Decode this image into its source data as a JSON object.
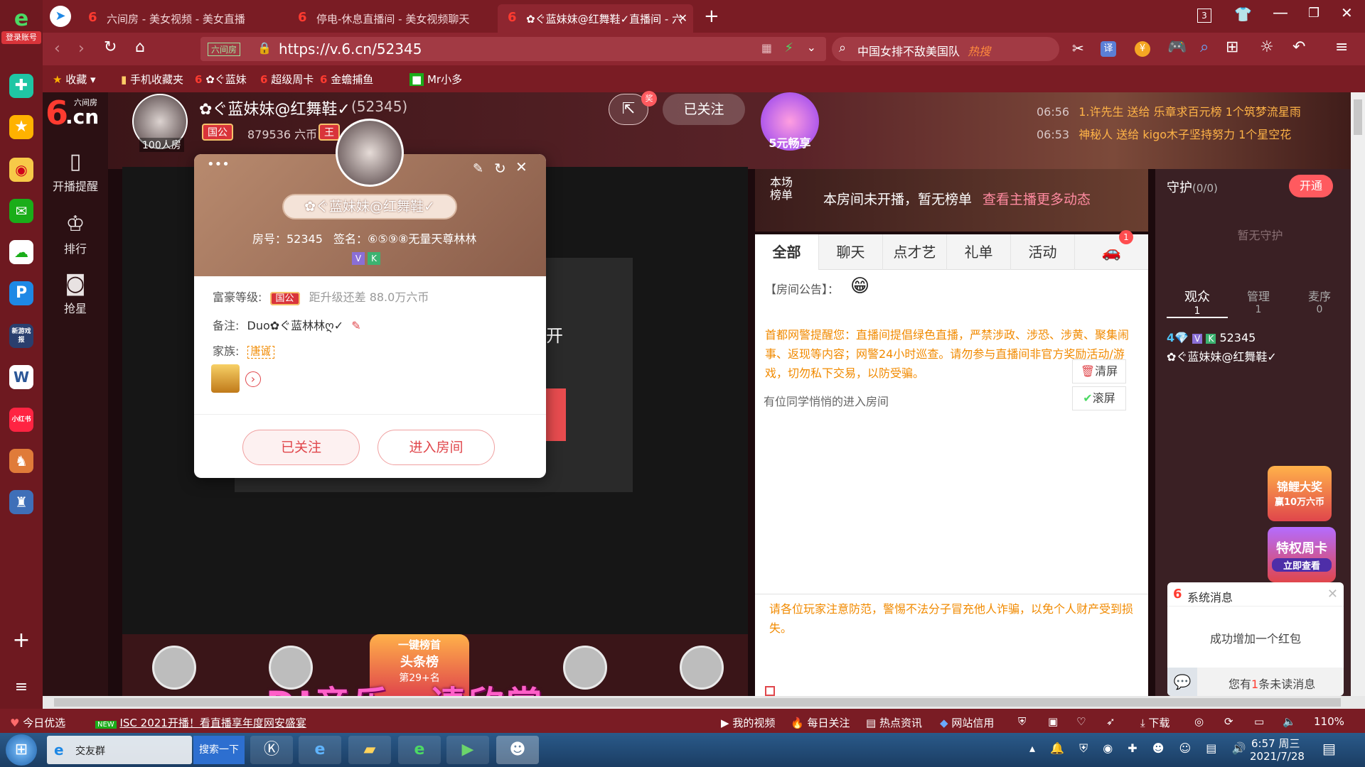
{
  "left_sidebar": {
    "account_label": "登录账号",
    "icons": [
      "browser-logo-icon",
      "plus-cross-icon",
      "star-icon",
      "weibo-icon",
      "mail-icon",
      "cloud-icon",
      "p-app-icon",
      "game-news-icon",
      "word-doc-icon",
      "xiaohongshu-icon",
      "game-icon",
      "game-icon-2",
      "add-icon",
      "menu-icon"
    ],
    "game_news_label": "新游戏报",
    "xhs_label": "小红书"
  },
  "tabs": [
    {
      "label": "六间房 - 美女视频 - 美女直播"
    },
    {
      "label": "停电-休息直播间 - 美女视频聊天"
    },
    {
      "label": "✿ぐ蓝妹妹@红舞鞋✓直播间 - 六"
    }
  ],
  "window_counter": "3",
  "navbar": {
    "url": "https://v.6.cn/52345",
    "url_badge": "六间房",
    "search_text": "中国女排不敌美国队",
    "search_badge": "热搜",
    "translate_label": "译"
  },
  "bookmarks": [
    {
      "label": "收藏"
    },
    {
      "label": "手机收藏夹"
    },
    {
      "label": "✿ぐ蓝妹"
    },
    {
      "label": "超级周卡"
    },
    {
      "label": "金蟾捕鱼"
    },
    {
      "label": "Mr小多"
    }
  ],
  "site_nav": {
    "logo_text": ".cn",
    "logo_sub": "六间房",
    "items": [
      {
        "label": "开播提醒"
      },
      {
        "label": "排行"
      },
      {
        "label": "抢星"
      }
    ]
  },
  "header": {
    "room_count": "100人房",
    "anchor_name": "✿ぐ蓝妹妹@红舞鞋✓",
    "room_id": "(52345)",
    "rank_badge": "国公",
    "coins": "879536 六币",
    "king_badge": "王",
    "follow_label": "已关注",
    "share_badge": "奖",
    "promo_label": "5元畅享",
    "feed": [
      {
        "time": "06:56",
        "text": "1.许先生 送给 乐章求百元榜 1个筑梦流星雨"
      },
      {
        "time": "06:53",
        "text": "神秘人 送给 kigo木子坚持努力 1个星空花"
      }
    ]
  },
  "rank": {
    "label": "本场榜单",
    "not_live_text": "本房间未开播，暂无榜单",
    "more_link": "查看主播更多动态"
  },
  "video": {
    "partial_text": "开"
  },
  "chat": {
    "tabs": [
      {
        "label": "全部"
      },
      {
        "label": "聊天"
      },
      {
        "label": "点才艺"
      },
      {
        "label": "礼单"
      },
      {
        "label": "活动"
      }
    ],
    "car_badge": "1",
    "notice_label": "【房间公告】：",
    "police_notice": "首都网警提醒您：直播间提倡绿色直播，严禁涉政、涉恐、涉黄、聚集闹事、返现等内容；网警24小时巡查。请勿参与直播间非官方奖励活动/游戏，切勿私下交易，以防受骗。",
    "clear_label": "清屏",
    "scroll_label": "滚屏",
    "enter_msg": "有位同学悄悄的进入房间",
    "warning": "请各位玩家注意防范，警惕不法分子冒充他人诈骗，以免个人财产受到损失。"
  },
  "guard": {
    "title": "守护",
    "count": "(0/0)",
    "open_label": "开通",
    "empty_text": "暂无守护",
    "tabs": [
      {
        "label": "观众",
        "count": "1"
      },
      {
        "label": "管理",
        "count": "1"
      },
      {
        "label": "麦序",
        "count": "0"
      }
    ],
    "viewer_level": "4",
    "viewer_id": "52345",
    "viewer_name": "✿ぐ蓝妹妹@红舞鞋✓",
    "promo1_line1": "锦鲤大奖",
    "promo1_line2": "赢10万六币",
    "promo2_line1": "特权周卡",
    "promo2_line2": "立即查看"
  },
  "sys_msg": {
    "title": "系统消息",
    "body": "成功增加一个红包",
    "unread_prefix": "您有",
    "unread_count": "1",
    "unread_suffix": "条未读消息"
  },
  "gift_strip": {
    "rank_badge_line1": "一键榜首",
    "rank_badge_line2": "头条榜",
    "rank_badge_line3": "第29+名",
    "overlay_text": "DJ音乐，请欣赏"
  },
  "modal": {
    "name": "✿ぐ蓝妹妹@红舞鞋✓",
    "room_label": "房号：52345",
    "sign_label": "签名：⑥⑤⑨⑧无量天尊林林",
    "badge_v": "V",
    "badge_k": "K",
    "wealth_label": "富豪等级:",
    "wealth_badge": "国公",
    "wealth_gap": "距升级还差 88.0万六币",
    "note_label": "备注:",
    "note_value": "Duo✿ぐ蓝林林ღ✓",
    "family_label": "家族:",
    "family_badge": "唐诚",
    "followed_btn": "已关注",
    "enter_btn": "进入房间"
  },
  "statusbar": {
    "left": [
      {
        "label": "今日优选"
      },
      {
        "label": "ISC 2021开播！看直播享年度网安盛宴"
      }
    ],
    "new_badge": "NEW",
    "right": [
      {
        "label": "我的视频"
      },
      {
        "label": "每日关注"
      },
      {
        "label": "热点资讯"
      },
      {
        "label": "网站信用"
      },
      {
        "label": "下载"
      }
    ],
    "zoom": "110%"
  },
  "taskbar": {
    "window_label": "交友群",
    "search_label": "搜索一下",
    "time": "6:57 周三",
    "date": "2021/7/28"
  },
  "colors": {
    "brand": "#8e2630",
    "accent": "#e0464b",
    "gold": "#e8a24a"
  }
}
